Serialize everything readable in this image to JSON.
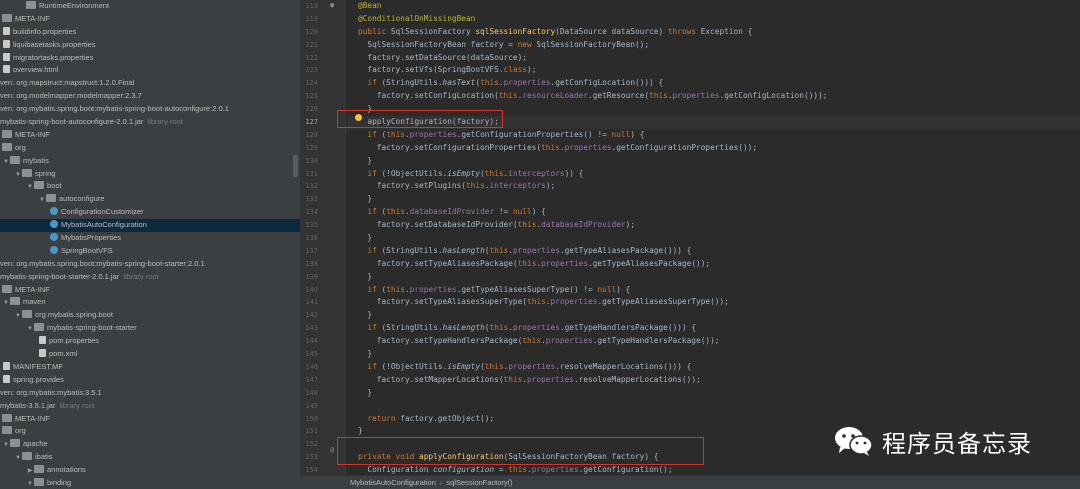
{
  "tree": [
    {
      "indent": 2,
      "arrow": "",
      "icon": "folder",
      "label": "RuntimeEnvironment",
      "tag": ""
    },
    {
      "indent": 0,
      "arrow": "",
      "icon": "folder",
      "label": "META-INF",
      "tag": ""
    },
    {
      "indent": 0,
      "arrow": "",
      "icon": "file",
      "label": "buildinfo.properties",
      "tag": ""
    },
    {
      "indent": 0,
      "arrow": "",
      "icon": "file",
      "label": "liquibasetasks.properties",
      "tag": ""
    },
    {
      "indent": 0,
      "arrow": "",
      "icon": "file",
      "label": "migratortasks.properties",
      "tag": ""
    },
    {
      "indent": 0,
      "arrow": "",
      "icon": "file",
      "label": "overview.html",
      "tag": ""
    },
    {
      "indent": -1,
      "arrow": "",
      "icon": "",
      "label": "ven: org.mapstruct:mapstruct:1.2.0.Final",
      "tag": ""
    },
    {
      "indent": -1,
      "arrow": "",
      "icon": "",
      "label": "ven: org.modelmapper:modelmapper:2.3.7",
      "tag": ""
    },
    {
      "indent": -1,
      "arrow": "",
      "icon": "",
      "label": "ven: org.mybatis.spring.boot:mybatis-spring-boot-autoconfigure:2.0.1",
      "tag": ""
    },
    {
      "indent": -1,
      "arrow": "",
      "icon": "",
      "label": "mybatis-spring-boot-autoconfigure-2.0.1.jar",
      "tag": "library root"
    },
    {
      "indent": 0,
      "arrow": "",
      "icon": "folder",
      "label": "META-INF",
      "tag": ""
    },
    {
      "indent": 0,
      "arrow": "",
      "icon": "folder",
      "label": "org",
      "tag": ""
    },
    {
      "indent": 0,
      "arrow": "▼",
      "icon": "pkg",
      "label": "mybatis",
      "tag": ""
    },
    {
      "indent": 1,
      "arrow": "▼",
      "icon": "pkg",
      "label": "spring",
      "tag": ""
    },
    {
      "indent": 2,
      "arrow": "▼",
      "icon": "pkg",
      "label": "boot",
      "tag": ""
    },
    {
      "indent": 3,
      "arrow": "▼",
      "icon": "pkg",
      "label": "autoconfigure",
      "tag": ""
    },
    {
      "indent": 4,
      "arrow": "",
      "icon": "class",
      "label": "ConfigurationCustomizer",
      "tag": ""
    },
    {
      "indent": 4,
      "arrow": "",
      "icon": "class",
      "label": "MybatisAutoConfiguration",
      "tag": "",
      "selected": true
    },
    {
      "indent": 4,
      "arrow": "",
      "icon": "class",
      "label": "MybatisProperties",
      "tag": ""
    },
    {
      "indent": 4,
      "arrow": "",
      "icon": "class",
      "label": "SpringBootVFS",
      "tag": ""
    },
    {
      "indent": -1,
      "arrow": "",
      "icon": "",
      "label": "ven: org.mybatis.spring.boot:mybatis-spring-boot-starter:2.0.1",
      "tag": ""
    },
    {
      "indent": -1,
      "arrow": "",
      "icon": "",
      "label": "mybatis-spring-boot-starter-2.0.1.jar",
      "tag": "library root"
    },
    {
      "indent": 0,
      "arrow": "",
      "icon": "folder",
      "label": "META-INF",
      "tag": ""
    },
    {
      "indent": 0,
      "arrow": "▼",
      "icon": "folder",
      "label": "maven",
      "tag": ""
    },
    {
      "indent": 1,
      "arrow": "▼",
      "icon": "pkg",
      "label": "org.mybatis.spring.boot",
      "tag": ""
    },
    {
      "indent": 2,
      "arrow": "▼",
      "icon": "pkg",
      "label": "mybatis-spring-boot-starter",
      "tag": ""
    },
    {
      "indent": 3,
      "arrow": "",
      "icon": "file",
      "label": "pom.properties",
      "tag": ""
    },
    {
      "indent": 3,
      "arrow": "",
      "icon": "file",
      "label": "pom.xml",
      "tag": ""
    },
    {
      "indent": 0,
      "arrow": "",
      "icon": "file",
      "label": "MANIFEST.MF",
      "tag": ""
    },
    {
      "indent": 0,
      "arrow": "",
      "icon": "file",
      "label": "spring.provides",
      "tag": ""
    },
    {
      "indent": -1,
      "arrow": "",
      "icon": "",
      "label": "ven: org.mybatis:mybatis:3.5.1",
      "tag": ""
    },
    {
      "indent": -1,
      "arrow": "",
      "icon": "",
      "label": "mybatis-3.5.1.jar",
      "tag": "library root"
    },
    {
      "indent": 0,
      "arrow": "",
      "icon": "folder",
      "label": "META-INF",
      "tag": ""
    },
    {
      "indent": 0,
      "arrow": "",
      "icon": "folder",
      "label": "org",
      "tag": ""
    },
    {
      "indent": 0,
      "arrow": "▼",
      "icon": "pkg",
      "label": "apache",
      "tag": ""
    },
    {
      "indent": 1,
      "arrow": "▼",
      "icon": "pkg",
      "label": "ibatis",
      "tag": ""
    },
    {
      "indent": 2,
      "arrow": "▶",
      "icon": "pkg",
      "label": "annotations",
      "tag": ""
    },
    {
      "indent": 2,
      "arrow": "▼",
      "icon": "pkg",
      "label": "binding",
      "tag": ""
    }
  ],
  "editor": {
    "current_line": 127,
    "lines": [
      {
        "n": 118,
        "code": [
          [
            "ann",
            "@Bean"
          ]
        ]
      },
      {
        "n": 119,
        "code": [
          [
            "ann",
            "@ConditionalOnMissingBean"
          ]
        ]
      },
      {
        "n": 120,
        "code": [
          [
            "kw",
            "public "
          ],
          [
            "t",
            "SqlSessionFactory "
          ],
          [
            "fn",
            "sqlSessionFactory"
          ],
          [
            "t",
            "(DataSource dataSource) "
          ],
          [
            "kw",
            "throws "
          ],
          [
            "t",
            "Exception {"
          ]
        ]
      },
      {
        "n": 121,
        "code": [
          [
            "t",
            "  SqlSessionFactoryBean factory = "
          ],
          [
            "kw",
            "new "
          ],
          [
            "t",
            "SqlSessionFactoryBean();"
          ]
        ]
      },
      {
        "n": 122,
        "code": [
          [
            "t",
            "  factory.setDataSource(dataSource);"
          ]
        ]
      },
      {
        "n": 123,
        "code": [
          [
            "t",
            "  factory.setVfs(SpringBootVFS."
          ],
          [
            "kw",
            "class"
          ],
          [
            "t",
            ");"
          ]
        ]
      },
      {
        "n": 124,
        "code": [
          [
            "t",
            "  "
          ],
          [
            "kw",
            "if "
          ],
          [
            "t",
            "(StringUtils."
          ],
          [
            "st",
            "hasText"
          ],
          [
            "t",
            "("
          ],
          [
            "kw",
            "this"
          ],
          [
            "t",
            "."
          ],
          [
            "fld",
            "properties"
          ],
          [
            "t",
            ".getConfigLocation())) {"
          ]
        ]
      },
      {
        "n": 125,
        "code": [
          [
            "t",
            "    factory.setConfigLocation("
          ],
          [
            "kw",
            "this"
          ],
          [
            "t",
            "."
          ],
          [
            "fld",
            "resourceLoader"
          ],
          [
            "t",
            ".getResource("
          ],
          [
            "kw",
            "this"
          ],
          [
            "t",
            "."
          ],
          [
            "fld",
            "properties"
          ],
          [
            "t",
            ".getConfigLocation()));"
          ]
        ]
      },
      {
        "n": 126,
        "code": [
          [
            "t",
            "  }"
          ]
        ]
      },
      {
        "n": 127,
        "code": [
          [
            "t",
            "  applyConfiguration(factory);"
          ]
        ]
      },
      {
        "n": 128,
        "code": [
          [
            "t",
            "  "
          ],
          [
            "kw",
            "if "
          ],
          [
            "t",
            "("
          ],
          [
            "kw",
            "this"
          ],
          [
            "t",
            "."
          ],
          [
            "fld",
            "properties"
          ],
          [
            "t",
            ".getConfigurationProperties() != "
          ],
          [
            "kw",
            "null"
          ],
          [
            "t",
            ") {"
          ]
        ]
      },
      {
        "n": 129,
        "code": [
          [
            "t",
            "    factory.setConfigurationProperties("
          ],
          [
            "kw",
            "this"
          ],
          [
            "t",
            "."
          ],
          [
            "fld",
            "properties"
          ],
          [
            "t",
            ".getConfigurationProperties());"
          ]
        ]
      },
      {
        "n": 130,
        "code": [
          [
            "t",
            "  }"
          ]
        ]
      },
      {
        "n": 131,
        "code": [
          [
            "t",
            "  "
          ],
          [
            "kw",
            "if "
          ],
          [
            "t",
            "(!ObjectUtils."
          ],
          [
            "st",
            "isEmpty"
          ],
          [
            "t",
            "("
          ],
          [
            "kw",
            "this"
          ],
          [
            "t",
            "."
          ],
          [
            "fld",
            "interceptors"
          ],
          [
            "t",
            ")) {"
          ]
        ]
      },
      {
        "n": 132,
        "code": [
          [
            "t",
            "    factory.setPlugins("
          ],
          [
            "kw",
            "this"
          ],
          [
            "t",
            "."
          ],
          [
            "fld",
            "interceptors"
          ],
          [
            "t",
            ");"
          ]
        ]
      },
      {
        "n": 133,
        "code": [
          [
            "t",
            "  }"
          ]
        ]
      },
      {
        "n": 134,
        "code": [
          [
            "t",
            "  "
          ],
          [
            "kw",
            "if "
          ],
          [
            "t",
            "("
          ],
          [
            "kw",
            "this"
          ],
          [
            "t",
            "."
          ],
          [
            "fld",
            "databaseIdProvider"
          ],
          [
            "t",
            " != "
          ],
          [
            "kw",
            "null"
          ],
          [
            "t",
            ") {"
          ]
        ]
      },
      {
        "n": 135,
        "code": [
          [
            "t",
            "    factory.setDatabaseIdProvider("
          ],
          [
            "kw",
            "this"
          ],
          [
            "t",
            "."
          ],
          [
            "fld",
            "databaseIdProvider"
          ],
          [
            "t",
            ");"
          ]
        ]
      },
      {
        "n": 136,
        "code": [
          [
            "t",
            "  }"
          ]
        ]
      },
      {
        "n": 137,
        "code": [
          [
            "t",
            "  "
          ],
          [
            "kw",
            "if "
          ],
          [
            "t",
            "(StringUtils."
          ],
          [
            "st",
            "hasLength"
          ],
          [
            "t",
            "("
          ],
          [
            "kw",
            "this"
          ],
          [
            "t",
            "."
          ],
          [
            "fld",
            "properties"
          ],
          [
            "t",
            ".getTypeAliasesPackage())) {"
          ]
        ]
      },
      {
        "n": 138,
        "code": [
          [
            "t",
            "    factory.setTypeAliasesPackage("
          ],
          [
            "kw",
            "this"
          ],
          [
            "t",
            "."
          ],
          [
            "fld",
            "properties"
          ],
          [
            "t",
            ".getTypeAliasesPackage());"
          ]
        ]
      },
      {
        "n": 139,
        "code": [
          [
            "t",
            "  }"
          ]
        ]
      },
      {
        "n": 140,
        "code": [
          [
            "t",
            "  "
          ],
          [
            "kw",
            "if "
          ],
          [
            "t",
            "("
          ],
          [
            "kw",
            "this"
          ],
          [
            "t",
            "."
          ],
          [
            "fld",
            "properties"
          ],
          [
            "t",
            ".getTypeAliasesSuperType() != "
          ],
          [
            "kw",
            "null"
          ],
          [
            "t",
            ") {"
          ]
        ]
      },
      {
        "n": 141,
        "code": [
          [
            "t",
            "    factory.setTypeAliasesSuperType("
          ],
          [
            "kw",
            "this"
          ],
          [
            "t",
            "."
          ],
          [
            "fld",
            "properties"
          ],
          [
            "t",
            ".getTypeAliasesSuperType());"
          ]
        ]
      },
      {
        "n": 142,
        "code": [
          [
            "t",
            "  }"
          ]
        ]
      },
      {
        "n": 143,
        "code": [
          [
            "t",
            "  "
          ],
          [
            "kw",
            "if "
          ],
          [
            "t",
            "(StringUtils."
          ],
          [
            "st",
            "hasLength"
          ],
          [
            "t",
            "("
          ],
          [
            "kw",
            "this"
          ],
          [
            "t",
            "."
          ],
          [
            "fld",
            "properties"
          ],
          [
            "t",
            ".getTypeHandlersPackage())) {"
          ]
        ]
      },
      {
        "n": 144,
        "code": [
          [
            "t",
            "    factory.setTypeHandlersPackage("
          ],
          [
            "kw",
            "this"
          ],
          [
            "t",
            "."
          ],
          [
            "fld",
            "properties"
          ],
          [
            "t",
            ".getTypeHandlersPackage());"
          ]
        ]
      },
      {
        "n": 145,
        "code": [
          [
            "t",
            "  }"
          ]
        ]
      },
      {
        "n": 146,
        "code": [
          [
            "t",
            "  "
          ],
          [
            "kw",
            "if "
          ],
          [
            "t",
            "(!ObjectUtils."
          ],
          [
            "st",
            "isEmpty"
          ],
          [
            "t",
            "("
          ],
          [
            "kw",
            "this"
          ],
          [
            "t",
            "."
          ],
          [
            "fld",
            "properties"
          ],
          [
            "t",
            ".resolveMapperLocations())) {"
          ]
        ]
      },
      {
        "n": 147,
        "code": [
          [
            "t",
            "    factory.setMapperLocations("
          ],
          [
            "kw",
            "this"
          ],
          [
            "t",
            "."
          ],
          [
            "fld",
            "properties"
          ],
          [
            "t",
            ".resolveMapperLocations());"
          ]
        ]
      },
      {
        "n": 148,
        "code": [
          [
            "t",
            "  }"
          ]
        ]
      },
      {
        "n": 149,
        "code": []
      },
      {
        "n": 150,
        "code": [
          [
            "t",
            "  "
          ],
          [
            "kw",
            "return "
          ],
          [
            "t",
            "factory.getObject();"
          ]
        ]
      },
      {
        "n": 151,
        "code": [
          [
            "t",
            "}"
          ]
        ]
      },
      {
        "n": 152,
        "code": []
      },
      {
        "n": 153,
        "code": [
          [
            "kw",
            "private void "
          ],
          [
            "fn",
            "applyConfiguration"
          ],
          [
            "t",
            "(SqlSessionFactoryBean factory) {"
          ]
        ]
      },
      {
        "n": 154,
        "code": [
          [
            "t",
            "  Configuration "
          ],
          [
            "it",
            "configuration"
          ],
          [
            "t",
            " = "
          ],
          [
            "kw",
            "this"
          ],
          [
            "t",
            "."
          ],
          [
            "fld",
            "properties"
          ],
          [
            "t",
            ".getConfiguration();"
          ]
        ]
      }
    ]
  },
  "breadcrumbs": [
    "MybatisAutoConfiguration",
    "sqlSessionFactory()"
  ],
  "watermark": {
    "text": "程序员备忘录"
  },
  "colors": {
    "highlight_box": "#d9322b",
    "selection": "#0d293e"
  }
}
